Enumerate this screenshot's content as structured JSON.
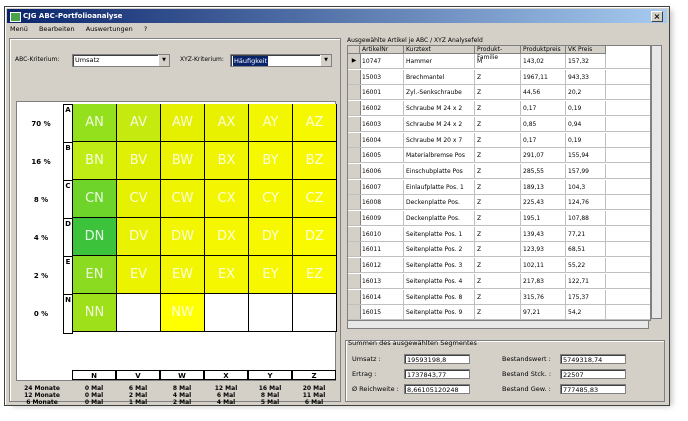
{
  "window": {
    "title": "CJG ABC-Portfolioanalyse",
    "close_label": "×"
  },
  "menu": [
    "Menü",
    "Bearbeiten",
    "Auswertungen",
    "?"
  ],
  "filters": {
    "abc_label": "ABC-Kriterium:",
    "abc_value": "Umsatz",
    "xyz_label": "XYZ-Kriterium:",
    "xyz_value": "Häufigkeit"
  },
  "matrix": {
    "row_labels": [
      "70 %",
      "16 %",
      "8 %",
      "4 %",
      "2 %",
      "0 %"
    ],
    "row_codes": [
      "A",
      "B",
      "C",
      "D",
      "E",
      "N"
    ],
    "col_codes": [
      "N",
      "V",
      "W",
      "X",
      "Y",
      "Z"
    ],
    "cells": [
      {
        "label": "AN",
        "color": "#94e01c"
      },
      {
        "label": "AV",
        "color": "#c4ea10"
      },
      {
        "label": "AW",
        "color": "#e4f000"
      },
      {
        "label": "AX",
        "color": "#e8f200"
      },
      {
        "label": "AY",
        "color": "#f2f600"
      },
      {
        "label": "AZ",
        "color": "#f6f800"
      },
      {
        "label": "BN",
        "color": "#c0ec16"
      },
      {
        "label": "BV",
        "color": "#e0f004"
      },
      {
        "label": "BW",
        "color": "#ecf300"
      },
      {
        "label": "BX",
        "color": "#f0f400"
      },
      {
        "label": "BY",
        "color": "#f6f800"
      },
      {
        "label": "BZ",
        "color": "#f8f900"
      },
      {
        "label": "CN",
        "color": "#6fd42a"
      },
      {
        "label": "CV",
        "color": "#e6f102"
      },
      {
        "label": "CW",
        "color": "#eff400"
      },
      {
        "label": "CX",
        "color": "#f3f600"
      },
      {
        "label": "CY",
        "color": "#f6f800"
      },
      {
        "label": "CZ",
        "color": "#f8f900"
      },
      {
        "label": "DN",
        "color": "#3dc23b"
      },
      {
        "label": "DV",
        "color": "#e9f200"
      },
      {
        "label": "DW",
        "color": "#f2f600"
      },
      {
        "label": "DX",
        "color": "#f5f700"
      },
      {
        "label": "DY",
        "color": "#f7f800"
      },
      {
        "label": "DZ",
        "color": "#f9fa00"
      },
      {
        "label": "EN",
        "color": "#8bdc20"
      },
      {
        "label": "EV",
        "color": "#ecf300"
      },
      {
        "label": "EW",
        "color": "#f2f600"
      },
      {
        "label": "EX",
        "color": "#f5f700"
      },
      {
        "label": "EY",
        "color": "#f7f800"
      },
      {
        "label": "EZ",
        "color": "#f9fa00"
      },
      {
        "label": "NN",
        "color": "#9ee01a"
      },
      {
        "label": "NV",
        "color": "#ffffff"
      },
      {
        "label": "NW",
        "color": "#ffff00"
      },
      {
        "label": "NX",
        "color": "#ffffff"
      },
      {
        "label": "NY",
        "color": "#ffffff"
      },
      {
        "label": "NZ",
        "color": "#ffffff"
      }
    ]
  },
  "frequency": {
    "row_labels": [
      "24 Monate",
      "12 Monate",
      "6 Monate"
    ],
    "cols": [
      [
        "0 Mal",
        "0 Mal",
        "0 Mal"
      ],
      [
        "6 Mal",
        "2 Mal",
        "1 Mal"
      ],
      [
        "8 Mal",
        "4 Mal",
        "2 Mal"
      ],
      [
        "12 Mal",
        "6 Mal",
        "4 Mal"
      ],
      [
        "16 Mal",
        "8 Mal",
        "5 Mal"
      ],
      [
        "20 Mal",
        "11 Mal",
        "6 Mal"
      ]
    ]
  },
  "table": {
    "caption": "Ausgewählte Artikel je ABC / XYZ Analysefeld",
    "headers": [
      "ArtikelNr",
      "Kurztext",
      "Produkt-Familie",
      "Produktpreis",
      "VK Preis"
    ],
    "rows": [
      [
        "10747",
        "Hammer",
        "M",
        "143,02",
        "157,32"
      ],
      [
        "15003",
        "Brechmantel",
        "Z",
        "1967,11",
        "943,33"
      ],
      [
        "16001",
        "Zyl.-Senkschraube",
        "Z",
        "44,56",
        "20,2"
      ],
      [
        "16002",
        "Schraube M 24 x 2",
        "Z",
        "0,17",
        "0,19"
      ],
      [
        "16003",
        "Schraube M 24 x 2",
        "Z",
        "0,85",
        "0,94"
      ],
      [
        "16004",
        "Schraube M 20 x 7",
        "Z",
        "0,17",
        "0,19"
      ],
      [
        "16005",
        "Materialbremse Pos",
        "Z",
        "291,07",
        "155,94"
      ],
      [
        "16006",
        "Einschubplatte Pos",
        "Z",
        "285,55",
        "157,99"
      ],
      [
        "16007",
        "Einlaufplatte Pos. 1",
        "Z",
        "189,13",
        "104,3"
      ],
      [
        "16008",
        "Deckenplatte Pos.",
        "Z",
        "225,43",
        "124,76"
      ],
      [
        "16009",
        "Deckenplatte Pos.",
        "Z",
        "195,1",
        "107,88"
      ],
      [
        "16010",
        "Seitenplatte Pos. 1",
        "Z",
        "139,43",
        "77,21"
      ],
      [
        "16011",
        "Seitenplatte Pos. 2",
        "Z",
        "123,93",
        "68,51"
      ],
      [
        "16012",
        "Seitenplatte Pos. 3",
        "Z",
        "102,11",
        "55,22"
      ],
      [
        "16013",
        "Seitenplatte Pos. 4",
        "Z",
        "217,83",
        "122,71"
      ],
      [
        "16014",
        "Seitenplatte Pos. 8",
        "Z",
        "315,76",
        "175,37"
      ],
      [
        "16015",
        "Seitenplatte Pos. 9",
        "Z",
        "97,21",
        "54,2"
      ]
    ]
  },
  "summary": {
    "caption": "Summen des ausgewählten Segmentes",
    "umsatz_label": "Umsatz :",
    "umsatz_value": "19593198,8",
    "ertrag_label": "Ertrag :",
    "ertrag_value": "1737843,77",
    "reichweite_label": "Ø Reichweite :",
    "reichweite_value": "8,66105120248",
    "bestandswert_label": "Bestandswert :",
    "bestandswert_value": "5749318,74",
    "bestand_stck_label": "Bestand Stck. :",
    "bestand_stck_value": "22507",
    "bestand_gew_label": "Bestand Gew. :",
    "bestand_gew_value": "777485,83"
  }
}
